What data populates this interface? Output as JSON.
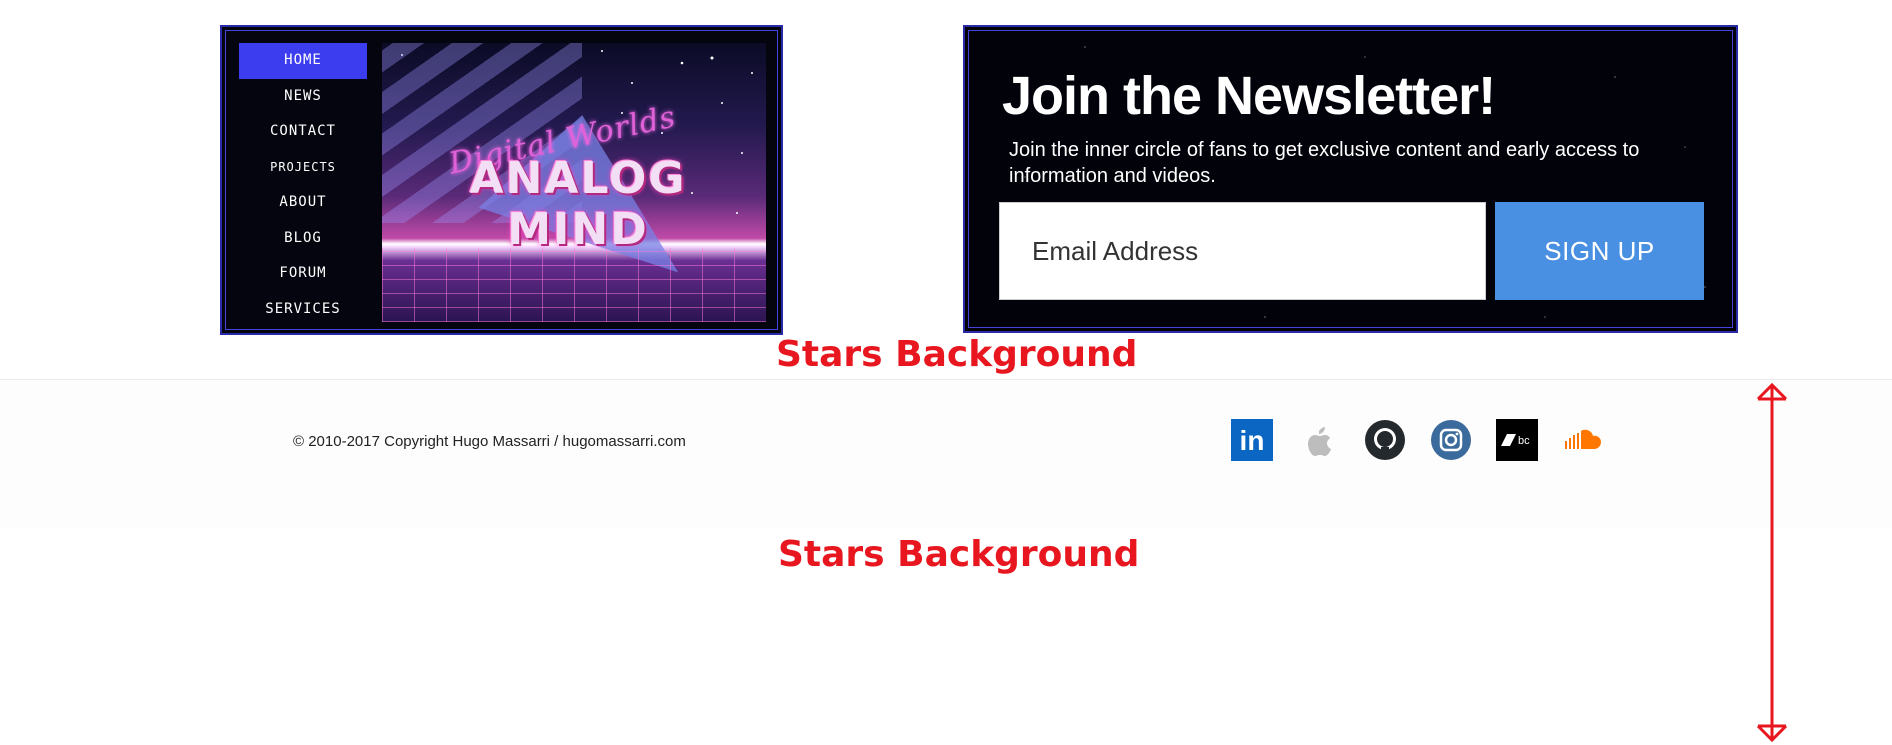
{
  "nav": {
    "items": [
      {
        "label": "HOME",
        "active": true
      },
      {
        "label": "NEWS"
      },
      {
        "label": "CONTACT"
      },
      {
        "label": "PROJECTS"
      },
      {
        "label": "ABOUT"
      },
      {
        "label": "BLOG"
      },
      {
        "label": "FORUM"
      },
      {
        "label": "SERVICES"
      }
    ],
    "active_color": "#3d3df0"
  },
  "hero": {
    "logo_script": "Digital Worlds",
    "logo_main": "ANALOG MIND"
  },
  "newsletter": {
    "title": "Join the Newsletter!",
    "description": "Join the inner circle of fans to get exclusive content and early access to information and videos.",
    "email_placeholder": "Email Address",
    "signup_label": "SIGN UP",
    "button_color": "#4a90e2"
  },
  "annotations": {
    "first": "Stars Background",
    "second": "Stars Background",
    "color": "#e8161e"
  },
  "footer": {
    "copyright": "© 2010-2017 Copyright Hugo Massarri / hugomassarri.com",
    "social": [
      {
        "icon": "linkedin-icon",
        "color": "#0a66c2"
      },
      {
        "icon": "apple-icon",
        "color": "#b5b5b5"
      },
      {
        "icon": "github-icon",
        "color": "#24292e"
      },
      {
        "icon": "instagram-icon",
        "color": "#3b6a9c"
      },
      {
        "icon": "bandcamp-icon",
        "color": "#000000"
      },
      {
        "icon": "soundcloud-icon",
        "color": "#ff7700"
      }
    ]
  }
}
